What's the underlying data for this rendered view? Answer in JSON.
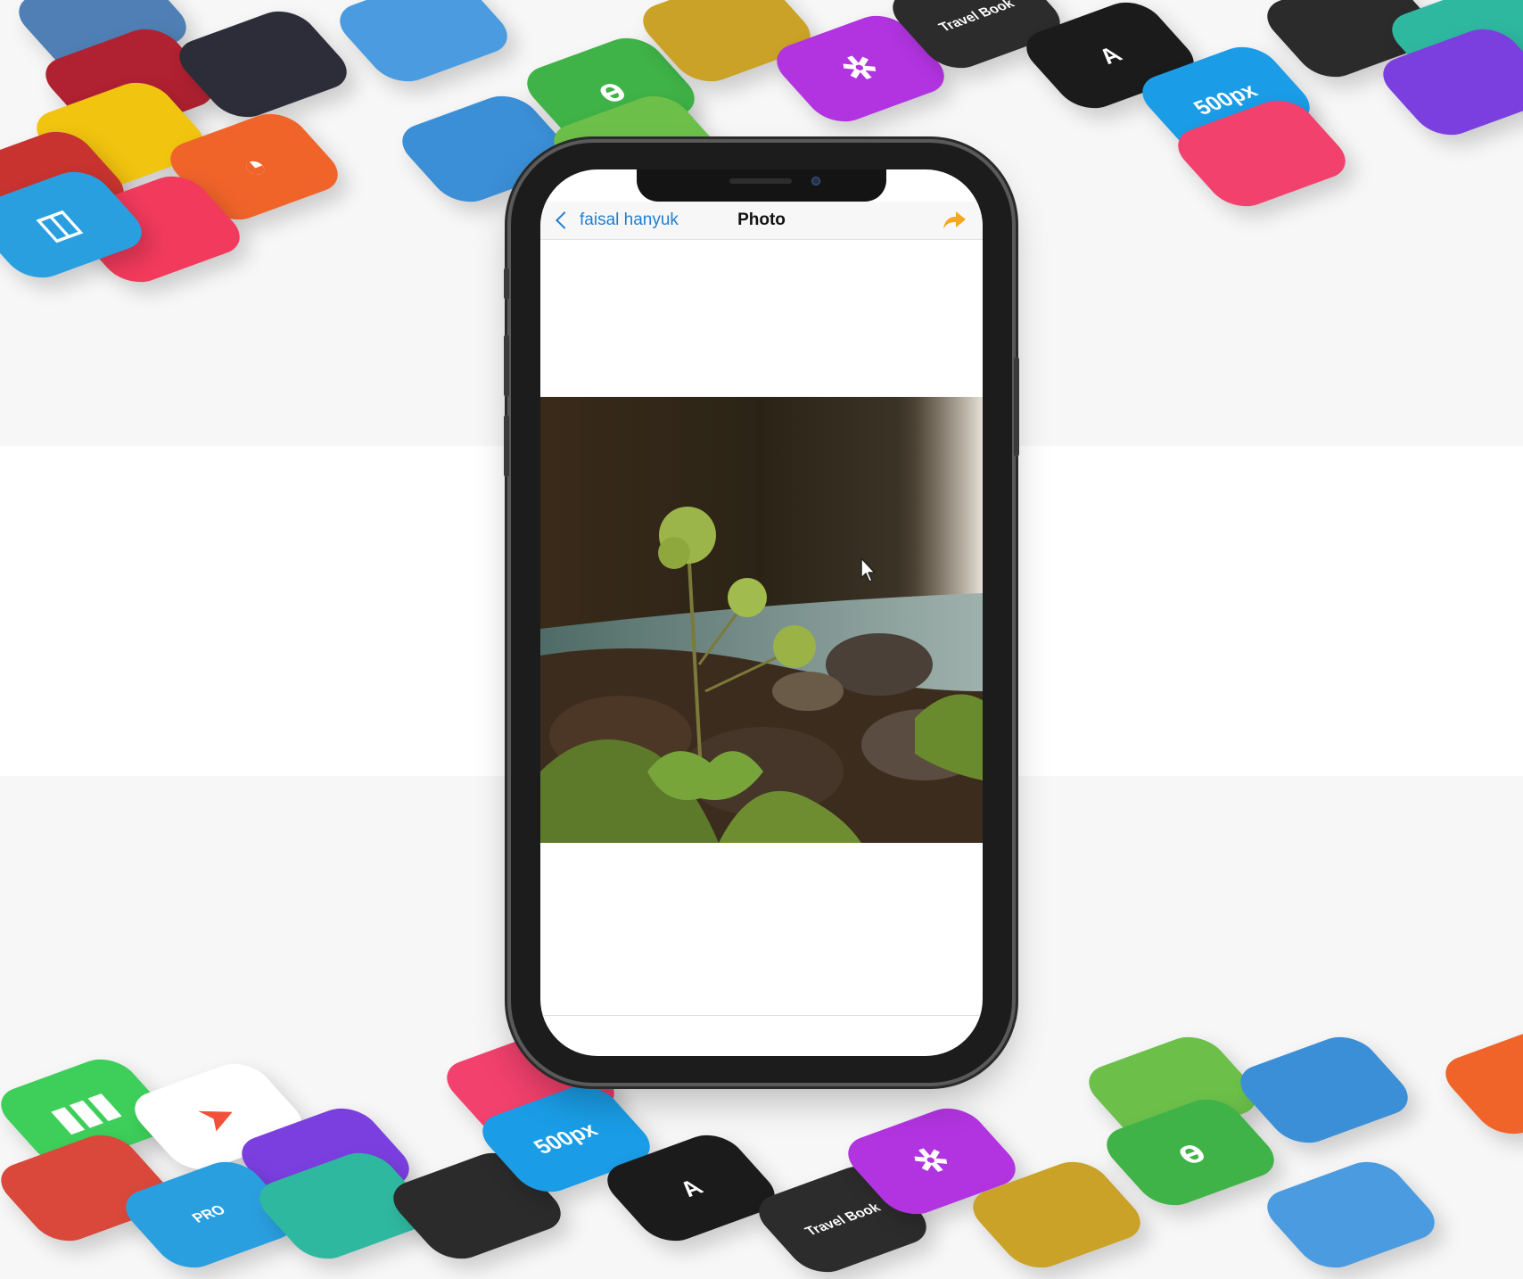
{
  "colors": {
    "link_blue": "#1f7fd4",
    "share_orange": "#f5a623",
    "background": "#f7f7f7"
  },
  "navbar": {
    "back_label": "faisal hanyuk",
    "title": "Photo",
    "back_icon": "chevron-left-icon",
    "share_icon": "share-arrow-icon"
  },
  "photo": {
    "subject": "flowering plant by rocky riverbank with waterfall"
  },
  "background_icons": {
    "px_label": "500px",
    "travel_label": "Travel Book",
    "a_label": "A",
    "pro_label": "PRO"
  }
}
